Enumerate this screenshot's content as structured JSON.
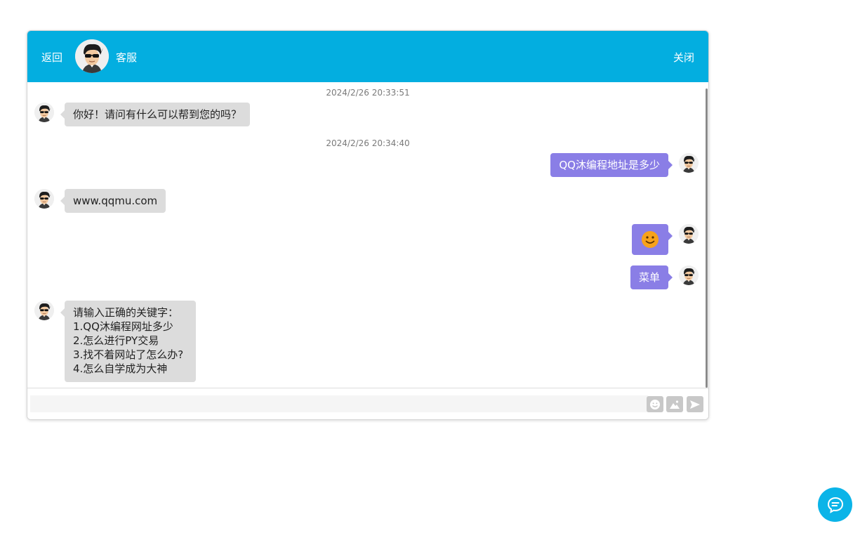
{
  "header": {
    "back_label": "返回",
    "agent_name": "客服",
    "close_label": "关闭"
  },
  "messages": [
    {
      "type": "timestamp",
      "text": "2024/2/26 20:33:51"
    },
    {
      "type": "incoming",
      "text": "你好！请问有什么可以帮到您的吗？"
    },
    {
      "type": "timestamp",
      "text": "2024/2/26 20:34:40"
    },
    {
      "type": "outgoing",
      "text": "QQ沐编程地址是多少"
    },
    {
      "type": "incoming",
      "text": "www.qqmu.com"
    },
    {
      "type": "outgoing",
      "emoji": "smile-emoji"
    },
    {
      "type": "outgoing",
      "text": "菜单"
    },
    {
      "type": "incoming",
      "lines": [
        "请输入正确的关键字：",
        "1.QQ沐编程网址多少",
        "2.怎么进行PY交易",
        "3.找不着网站了怎么办?",
        "4.怎么自学成为大神"
      ]
    }
  ],
  "input": {
    "placeholder": "",
    "value": ""
  },
  "toolbar": {
    "emoji_icon": "smiley-icon",
    "image_icon": "image-icon",
    "send_icon": "send-icon"
  },
  "colors": {
    "header": "#03aee0",
    "incoming_bubble": "#dcdcdc",
    "outgoing_bubble": "#8a7ee6",
    "float_button": "#0bb4e8"
  }
}
